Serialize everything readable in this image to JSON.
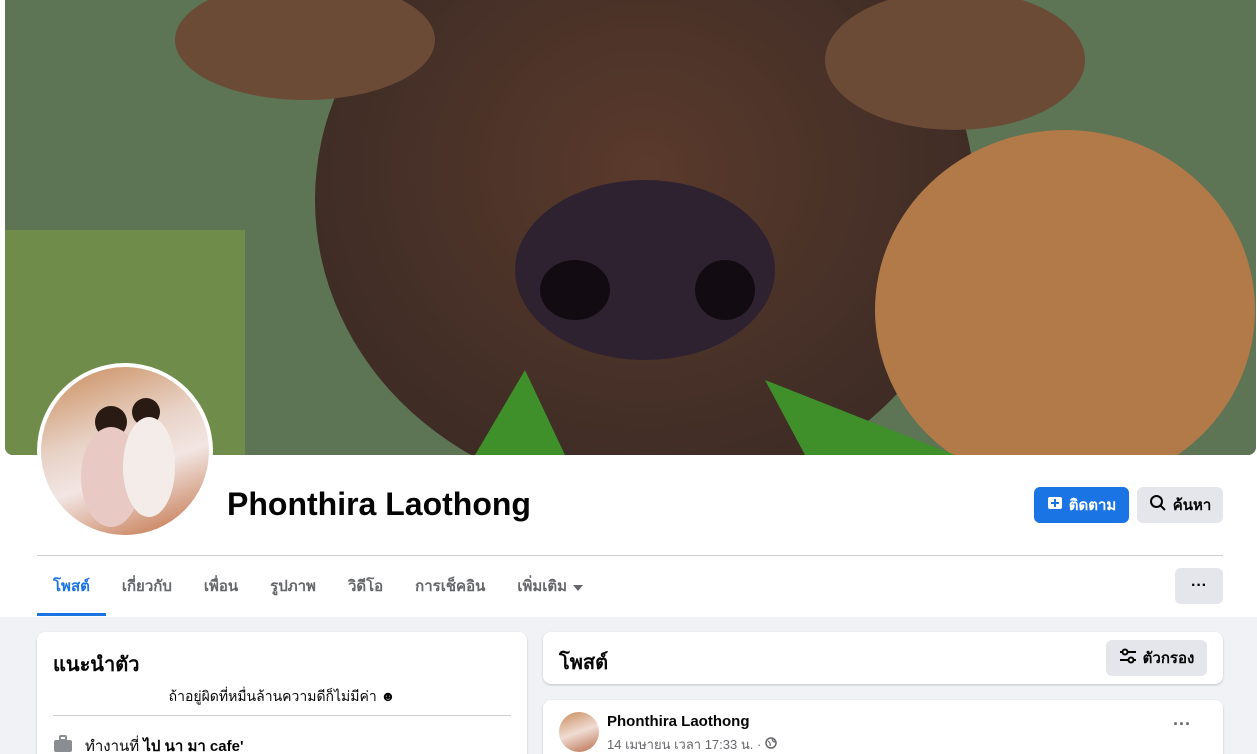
{
  "profile": {
    "name": "Phonthira Laothong"
  },
  "actions": {
    "follow_label": "ติดตาม",
    "search_label": "ค้นหา",
    "more_label": "···"
  },
  "tabs": [
    {
      "label": "โพสต์"
    },
    {
      "label": "เกี่ยวกับ"
    },
    {
      "label": "เพื่อน"
    },
    {
      "label": "รูปภาพ"
    },
    {
      "label": "วิดีโอ"
    },
    {
      "label": "การเช็คอิน"
    },
    {
      "label": "เพิ่มเติม"
    }
  ],
  "intro": {
    "title": "แนะนำตัว",
    "bio": "ถ้าอยู่ผิดที่หมื่นล้านความดีก็ไม่มีค่า ☻",
    "work_prefix": "ทำงานที่ ",
    "work_place": "ไป นา มา cafe'"
  },
  "posts": {
    "title": "โพสต์",
    "filter_label": "ตัวกรอง"
  },
  "post": {
    "author": "Phonthira Laothong",
    "time": "14 เมษายน เวลา 17:33 น. ·",
    "more": "···"
  },
  "colors": {
    "primary": "#1b74e4",
    "background": "#f0f2f5",
    "secondary_button": "#e4e6eb"
  },
  "icons": {
    "follow": "add-friend-icon",
    "search": "search-icon",
    "filter": "filter-icon",
    "work": "briefcase-icon",
    "privacy": "globe-icon",
    "dropdown": "caret-down-icon"
  }
}
